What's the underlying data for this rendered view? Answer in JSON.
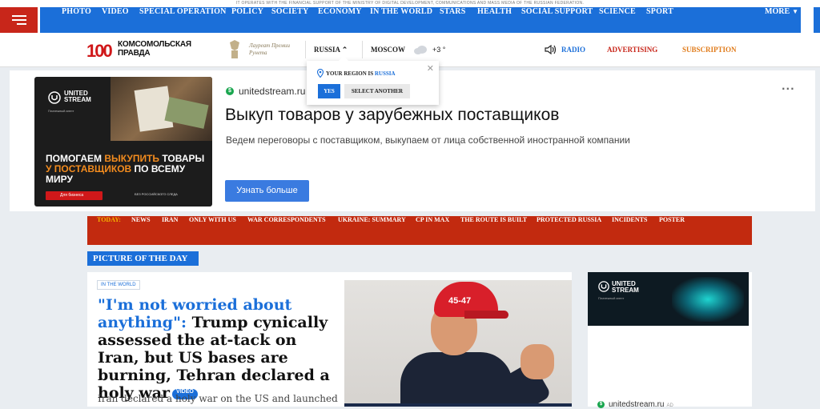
{
  "top_notice": "IT OPERATES WITH THE FINANCIAL SUPPORT OF THE MINISTRY OF DIGITAL DEVELOPMENT, COMMUNICATIONS AND MASS MEDIA OF THE RUSSIAN FEDERATION.",
  "nav": {
    "items": [
      "PHOTO",
      "VIDEO",
      "SPECIAL OPERATION",
      "POLICY",
      "SOCIETY",
      "ECONOMY",
      "IN THE WORLD",
      "STARS",
      "HEALTH",
      "SOCIAL SUPPORT",
      "SCIENCE",
      "SPORT"
    ],
    "more_label": "MORE",
    "colors": {
      "brand_red": "#c8261a",
      "brand_blue": "#1b6fd9"
    }
  },
  "header": {
    "logo_number": "100",
    "logo_name": "КОМСОМОЛЬСКАЯ ПРАВДА",
    "laureate": "Лауреат Премии Рунета",
    "region_label": "RUSSIA",
    "city": "MOSCOW",
    "temperature": "+3 °",
    "radio": "RADIO",
    "advertising": "ADVERTISING",
    "subscription": "SUBSCRIPTION"
  },
  "region_popup": {
    "prefix": "YOUR REGION IS",
    "region": "RUSSIA",
    "yes": "YES",
    "select_another": "SELECT ANOTHER"
  },
  "ad_top": {
    "brand": "UNITED STREAM",
    "brand_sub": "Платежный агент",
    "creative_headline_1": "ПОМОГАЕМ ",
    "creative_headline_hl": "ВЫКУПИТЬ",
    "creative_headline_2": " ТОВАРЫ ",
    "creative_headline_hl2": "У ПОСТАВЩИКОВ",
    "creative_headline_3": " ПО ВСЕМУ МИРУ",
    "creative_button": "Для бизнеса",
    "creative_note": "БЕЗ РОССИЙСКОГО СЛЕДА",
    "domain": "unitedstream.ru",
    "title": "Выкуп товаров у зарубежных поставщиков",
    "description": "Ведем переговоры с поставщиком, выкупаем от лица собственной иностранной компании",
    "cta": "Узнать больше"
  },
  "today": {
    "label": "TODAY:",
    "items": [
      "NEWS",
      "IRAN",
      "ONLY WITH US",
      "WAR CORRESPONDENTS",
      "UKRAINE: SUMMARY",
      "CP IN MAX",
      "THE ROUTE IS BUILT",
      "PROTECTED RUSSIA",
      "INCIDENTS",
      "POSTER"
    ]
  },
  "section_label": "PICTURE OF THE DAY",
  "article": {
    "category": "IN THE WORLD",
    "quote": "\"I'm not worried about anything\":",
    "headline": " Trump cynically assessed the at-tack on Iran, but US bases are burning, Tehran declared a holy war",
    "video_badge": "VIDEO",
    "lead": "Iran declared a holy war on the US and launched",
    "photo_cap_text": "45-47"
  },
  "side_ad": {
    "brand": "UNITED STREAM",
    "brand_sub": "Платежный агент",
    "domain": "unitedstream.ru",
    "ad_tag": "AD"
  }
}
